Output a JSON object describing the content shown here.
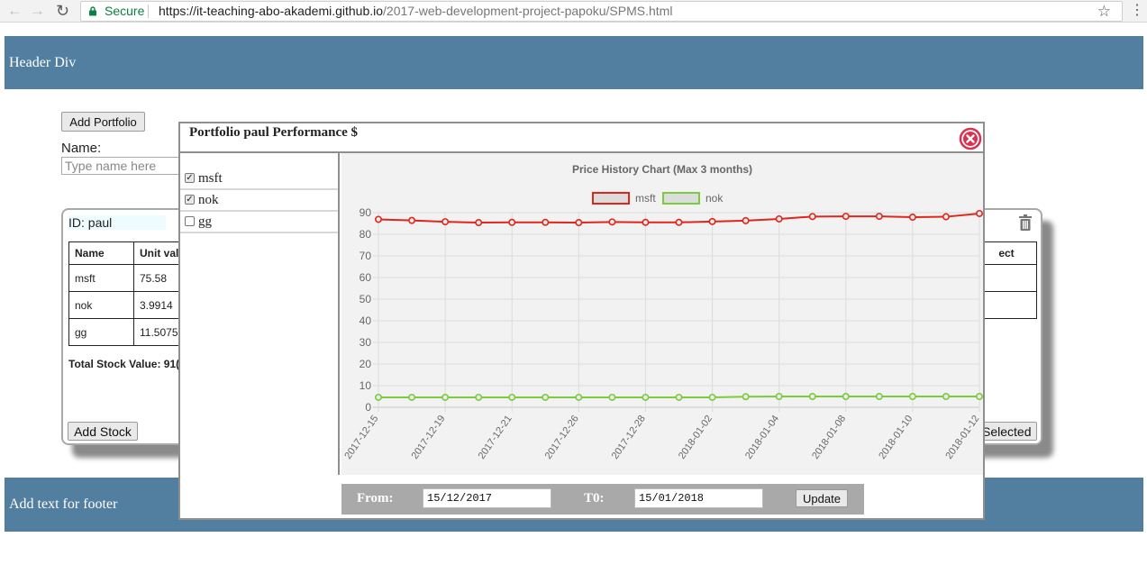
{
  "browser": {
    "secure_label": "Secure",
    "url_host": "https://it-teaching-abo-akademi.github.io",
    "url_path": "/2017-web-development-project-papoku/SPMS.html"
  },
  "page": {
    "header_text": "Header Div",
    "footer_text": "Add text for footer",
    "add_portfolio_label": "Add Portfolio",
    "name_label": "Name:",
    "name_placeholder": "Type name here"
  },
  "portfolio": {
    "id_label": "ID: paul",
    "columns": [
      "Name",
      "Unit val"
    ],
    "select_column": "ect",
    "rows": [
      {
        "name": "msft",
        "unit_value": "75.58"
      },
      {
        "name": "nok",
        "unit_value": "3.9914"
      },
      {
        "name": "gg",
        "unit_value": "11.5075"
      }
    ],
    "total_label": "Total Stock Value: 91(",
    "add_stock_label": "Add Stock",
    "remove_selected_label": "Selected"
  },
  "modal": {
    "title": "Portfolio paul Performance $",
    "stocks": [
      {
        "name": "msft",
        "checked": true
      },
      {
        "name": "nok",
        "checked": true
      },
      {
        "name": "gg",
        "checked": false
      }
    ],
    "from_label": "From:",
    "from_value": "15/12/2017",
    "to_label": "T0:",
    "to_value": "15/01/2018",
    "update_label": "Update"
  },
  "chart_data": {
    "type": "line",
    "title": "Price History Chart (Max 3 months)",
    "x": [
      "2017-12-15",
      "2017-12-18",
      "2017-12-19",
      "2017-12-20",
      "2017-12-21",
      "2017-12-22",
      "2017-12-26",
      "2017-12-27",
      "2017-12-28",
      "2017-12-29",
      "2018-01-02",
      "2018-01-03",
      "2018-01-04",
      "2018-01-05",
      "2018-01-08",
      "2018-01-09",
      "2018-01-10",
      "2018-01-11",
      "2018-01-12"
    ],
    "x_tick_labels": [
      "2017-12-15",
      "2017-12-19",
      "2017-12-21",
      "2017-12-26",
      "2017-12-28",
      "2018-01-02",
      "2018-01-04",
      "2018-01-08",
      "2018-01-10",
      "2018-01-12"
    ],
    "series": [
      {
        "name": "msft",
        "color": "#e0261b",
        "values": [
          86.9,
          86.4,
          85.8,
          85.4,
          85.5,
          85.5,
          85.4,
          85.7,
          85.5,
          85.5,
          85.9,
          86.3,
          87.1,
          88.2,
          88.3,
          88.3,
          87.9,
          88.1,
          89.6
        ]
      },
      {
        "name": "nok",
        "color": "#7acc3c",
        "values": [
          4.6,
          4.6,
          4.6,
          4.6,
          4.6,
          4.6,
          4.6,
          4.6,
          4.6,
          4.6,
          4.6,
          4.9,
          5.0,
          5.0,
          5.0,
          5.0,
          5.0,
          5.0,
          5.0
        ]
      }
    ],
    "ylim": [
      0,
      90
    ],
    "y_ticks": [
      0,
      10,
      20,
      30,
      40,
      50,
      60,
      70,
      80,
      90
    ],
    "grid": true,
    "legend": "top-center"
  }
}
